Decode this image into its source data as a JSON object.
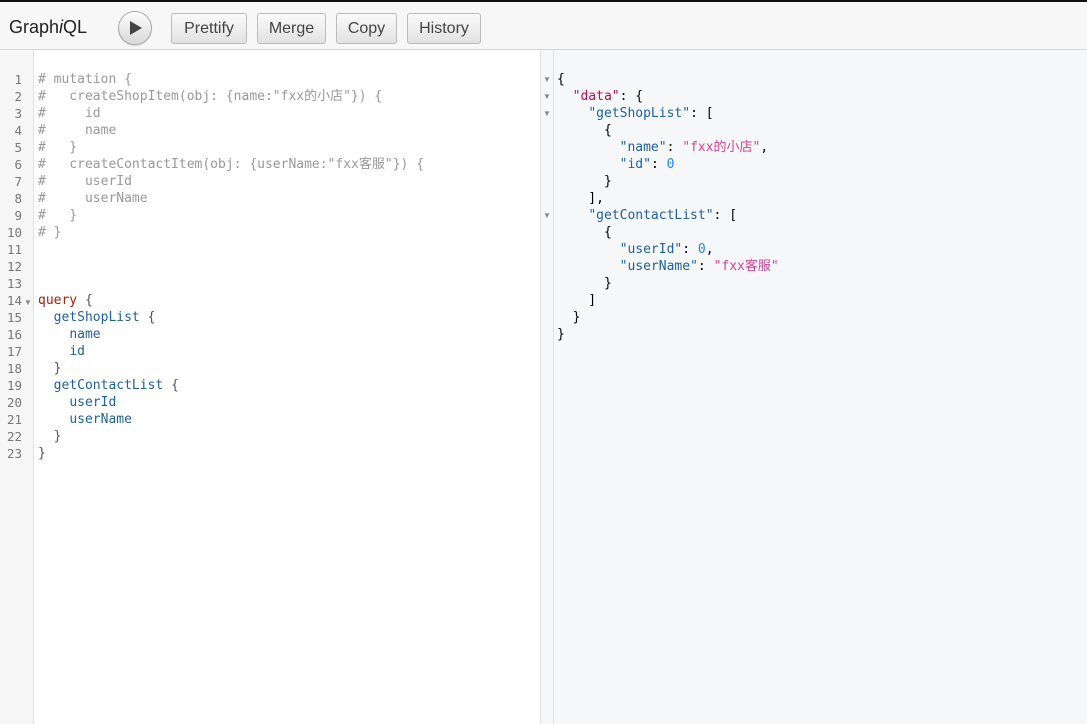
{
  "app": {
    "title_pre": "Graph",
    "title_ital": "i",
    "title_post": "QL"
  },
  "toolbar": {
    "run_label": "Execute Query",
    "buttons": [
      "Prettify",
      "Merge",
      "Copy",
      "History"
    ]
  },
  "editor": {
    "line_numbers": [
      "1",
      "2",
      "3",
      "4",
      "5",
      "6",
      "7",
      "8",
      "9",
      "10",
      "11",
      "12",
      "13",
      "14",
      "15",
      "16",
      "17",
      "18",
      "19",
      "20",
      "21",
      "22",
      "23"
    ],
    "lines": [
      "# mutation {",
      "#   createShopItem(obj: {name:\"fxx的小店\"}) {",
      "#     id",
      "#     name",
      "#   }",
      "#   createContactItem(obj: {userName:\"fxx客服\"}) {",
      "#     userId",
      "#     userName",
      "#   }",
      "# }",
      "",
      "",
      "",
      "query {",
      "  getShopList {",
      "    name",
      "    id",
      "  }",
      "  getContactList {",
      "    userId",
      "    userName",
      "  }",
      "}"
    ]
  },
  "result": {
    "lines": [
      "{",
      "  \"data\": {",
      "    \"getShopList\": [",
      "      {",
      "        \"name\": \"fxx的小店\",",
      "        \"id\": 0",
      "      }",
      "    ],",
      "    \"getContactList\": [",
      "      {",
      "        \"userId\": 0,",
      "        \"userName\": \"fxx客服\"",
      "      }",
      "    ]",
      "  }",
      "}"
    ]
  },
  "colors": {
    "comment": "#999999",
    "keyword": "#b11a04",
    "property": "#1f61a0",
    "string": "#d64292",
    "number": "#2882f9",
    "json_key": "#1f61a0"
  },
  "icons": {
    "run": "play-icon",
    "fold": "fold-arrow-icon"
  }
}
